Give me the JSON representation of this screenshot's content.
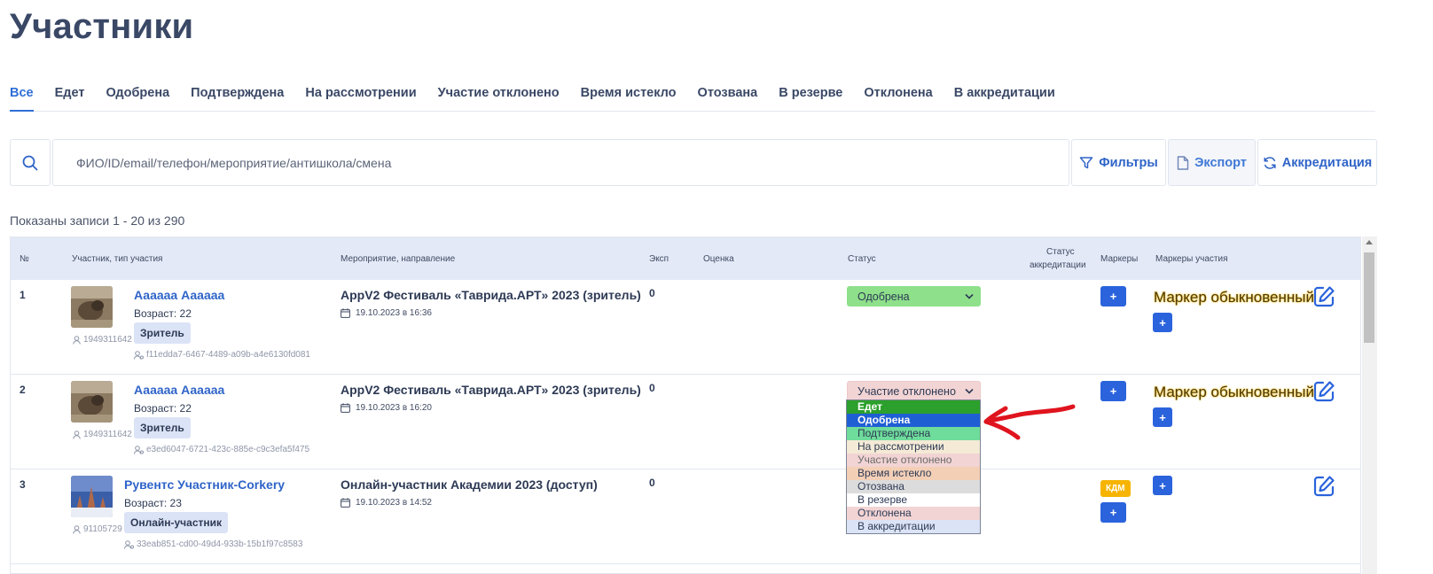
{
  "page_title": "Участники",
  "tabs": [
    "Все",
    "Едет",
    "Одобрена",
    "Подтверждена",
    "На рассмотрении",
    "Участие отклонено",
    "Время истекло",
    "Отозвана",
    "В резерве",
    "Отклонена",
    "В аккредитации"
  ],
  "search": {
    "placeholder": "ФИО/ID/email/телефон/мероприятие/антишкола/смена"
  },
  "toolbar": {
    "filters": "Фильтры",
    "export": "Экспорт",
    "accreditation": "Аккредитация"
  },
  "records_text": "Показаны записи 1 - 20 из 290",
  "table": {
    "headers": {
      "num": "№",
      "participant": "Участник, тип участия",
      "event": "Мероприятие, направление",
      "exp": "Эксп",
      "score": "Оценка",
      "status": "Статус",
      "accreditation_1": "Статус",
      "accreditation_2": "аккредитации",
      "markers": "Маркеры",
      "participation_markers": "Маркеры участия"
    },
    "rows": [
      {
        "num": "1",
        "name": "Аааааа Аааааа",
        "age": "Возраст: 22",
        "type": "Зритель",
        "id": "1949311642",
        "uuid": "f11edda7-6467-4489-a09b-a4e6130fd081",
        "event": "AppV2 Фестиваль «Таврида.АРТ» 2023 (зритель)",
        "date": "19.10.2023 в 16:36",
        "exp": "0",
        "status": "Одобрена",
        "marker_text": "Маркер обыкновенный",
        "plus": "+"
      },
      {
        "num": "2",
        "name": "Аааааа Аааааа",
        "age": "Возраст: 22",
        "type": "Зритель",
        "id": "1949311642",
        "uuid": "e3ed6047-6721-423c-885e-c9c3efa5f475",
        "event": "AppV2 Фестиваль «Таврида.АРТ» 2023 (зритель)",
        "date": "19.10.2023 в 16:20",
        "exp": "0",
        "status": "Участие отклонено",
        "marker_text": "Маркер обыкновенный",
        "plus": "+"
      },
      {
        "num": "3",
        "name": "Рувентс Участник-Corkery",
        "age": "Возраст: 23",
        "type": "Онлайн-участник",
        "id": "91105729",
        "uuid": "33eab851-cd00-49d4-933b-15b1f97c8583",
        "event": "Онлайн-участник Академии 2023 (доступ)",
        "date": "19.10.2023 в 14:52",
        "exp": "0",
        "marker_badge": "КДМ",
        "plus": "+"
      }
    ]
  },
  "dropdown": {
    "options": [
      {
        "label": "Едет",
        "bg": "#2ca02c",
        "fg": "#ffffff",
        "bold": true
      },
      {
        "label": "Одобрена",
        "bg": "#1f5fd4",
        "fg": "#ffffff",
        "bold": true
      },
      {
        "label": "Подтверждена",
        "bg": "#6edc9a",
        "fg": "#2d3a55",
        "bold": false
      },
      {
        "label": "На рассмотрении",
        "bg": "#f4ead6",
        "fg": "#2d3a55",
        "bold": false
      },
      {
        "label": "Участие отклонено",
        "bg": "#f2d4d4",
        "fg": "#6b6b6b",
        "bold": false
      },
      {
        "label": "Время истекло",
        "bg": "#f3cfb6",
        "fg": "#2d3a55",
        "bold": false
      },
      {
        "label": "Отозвана",
        "bg": "#dcdcdc",
        "fg": "#2d3a55",
        "bold": false
      },
      {
        "label": "В резерве",
        "bg": "#ffffff",
        "fg": "#2d3a55",
        "bold": false
      },
      {
        "label": "Отклонена",
        "bg": "#f2d4d4",
        "fg": "#2d3a55",
        "bold": false
      },
      {
        "label": "В аккредитации",
        "bg": "#dbe3f6",
        "fg": "#2d3a55",
        "bold": false
      }
    ]
  },
  "colors": {
    "accent": "#2f6fd6",
    "button_blue": "#2a63dc",
    "header_bg": "#e3e9f7",
    "arrow_red": "#e0141e",
    "kdm_badge": "#f6b400"
  }
}
